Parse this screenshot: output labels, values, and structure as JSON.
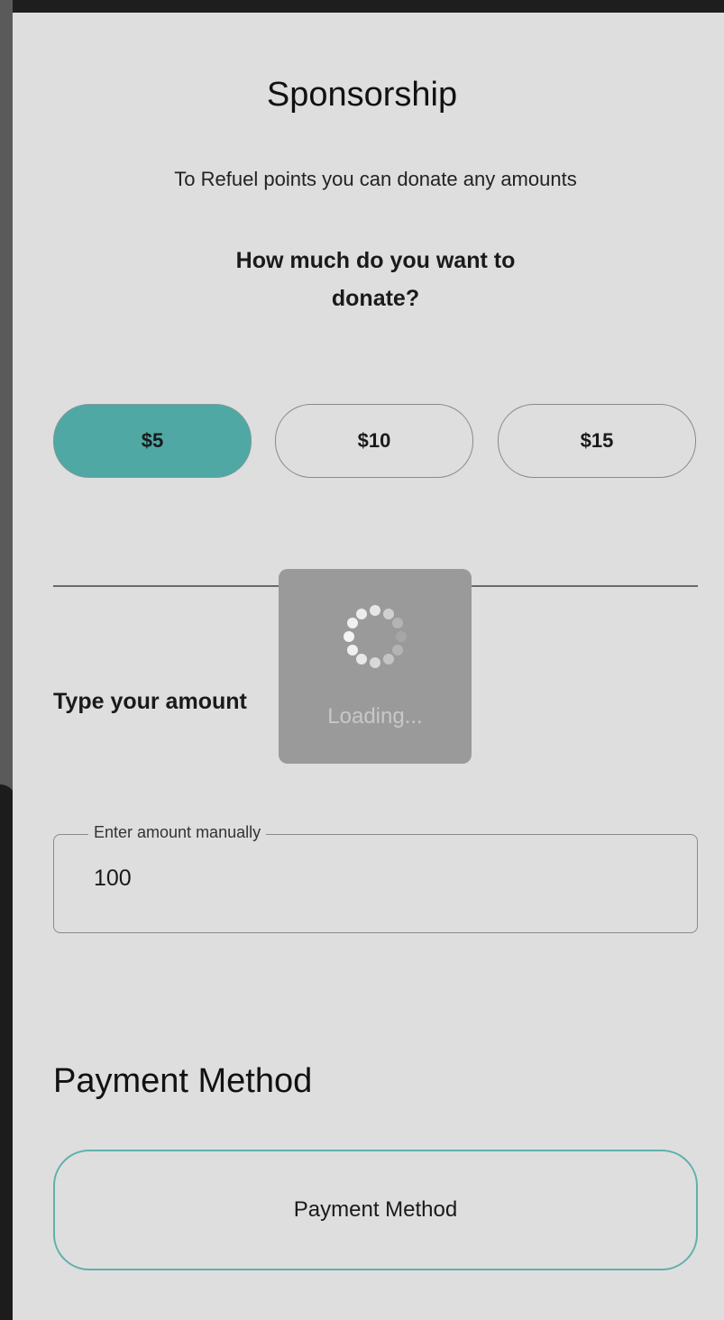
{
  "header": {
    "title": "Sponsorship",
    "subtitle": "To Refuel points you can donate any amounts",
    "question_line1": "How much do you want to",
    "question_line2": "donate?"
  },
  "amounts": [
    {
      "label": "$5",
      "selected": true
    },
    {
      "label": "$10",
      "selected": false
    },
    {
      "label": "$15",
      "selected": false
    }
  ],
  "custom_amount": {
    "label": "Type your amount",
    "field_label": "Enter amount manually",
    "value": "100"
  },
  "loading": {
    "text": "Loading..."
  },
  "payment": {
    "heading": "Payment Method",
    "button_label": "Payment Method"
  },
  "colors": {
    "accent": "#4fa8a3",
    "background": "#dedede"
  }
}
